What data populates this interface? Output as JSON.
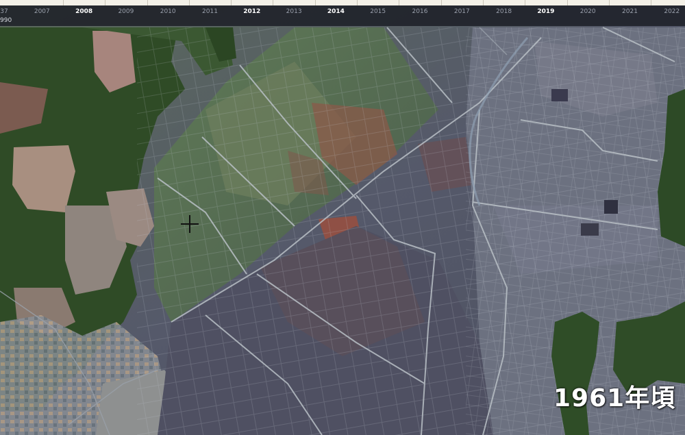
{
  "timeline": {
    "years": [
      {
        "label": "37",
        "major": false
      },
      {
        "label": "2007",
        "major": false
      },
      {
        "label": "2008",
        "major": true
      },
      {
        "label": "2009",
        "major": false
      },
      {
        "label": "2010",
        "major": false
      },
      {
        "label": "2011",
        "major": false
      },
      {
        "label": "2012",
        "major": true
      },
      {
        "label": "2013",
        "major": false
      },
      {
        "label": "2014",
        "major": true
      },
      {
        "label": "2015",
        "major": false
      },
      {
        "label": "2016",
        "major": false
      },
      {
        "label": "2017",
        "major": false
      },
      {
        "label": "2018",
        "major": false
      },
      {
        "label": "2019",
        "major": true
      },
      {
        "label": "2020",
        "major": false
      },
      {
        "label": "2021",
        "major": false
      },
      {
        "label": "2022",
        "major": false
      }
    ],
    "sub_label": "990"
  },
  "map": {
    "era_label": "1961年頃",
    "crosshair_icon": "crosshair-icon"
  },
  "colors": {
    "timebar_bg": "#1e2028",
    "track": "#f4f1e8",
    "forest": "#2c4a22",
    "paddy": "#5f6470"
  }
}
